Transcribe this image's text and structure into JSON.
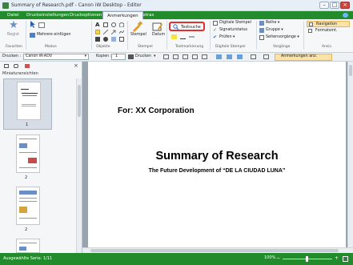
{
  "window": {
    "title": "Summary of Research.pdf - Canon iW Desktop - Editor",
    "min": "–",
    "max": "□",
    "close": "×"
  },
  "ribbon_tabs": [
    "Datei",
    "Druckeinstellungen",
    "Druckoptionen",
    "Anmerkungen",
    "Extras"
  ],
  "ribbon": {
    "regist_label": "Regist",
    "favoriten_group": "Favoriten",
    "mehrere_einfuegen": "Mehrere einfügen",
    "modus_group": "Modus",
    "objekte_group": "Objekte",
    "stempel_btn": "Stempel",
    "datum_btn": "Datum",
    "stempel_group": "Stempel",
    "textsuche_btn": "Textsuche",
    "textmarkierung_group": "Textmarkierung",
    "digitale_stempel": "Digitale Stempel",
    "signaturstatus": "Signaturstatus",
    "pruefen": "Prüfen ▾",
    "digitale_stempel_group": "Digitale Stempel",
    "reihe": "Reihe ▾",
    "gruppe": "Gruppe ▾",
    "seitenvorgaenge": "Seitenvorgänge ▾",
    "vorgaenge_group": "Vorgänge",
    "navigation": "Navigation",
    "formatsmt": "Formatsmt.",
    "ansicht_group": "Ansic."
  },
  "toolbar": {
    "drucken_label": "Drucken :",
    "printer": "Canon iR-ADV",
    "kopien_label": "Kopien :",
    "kopien_value": "1",
    "drucken_btn": "Drucken",
    "anmerkungen_btn": "Anmerkungen anz."
  },
  "left_panel": {
    "heading": "Miniaturansichten",
    "thumbs": [
      {
        "num": "1"
      },
      {
        "num": "2"
      },
      {
        "num": "2"
      },
      {
        "num": "2"
      }
    ]
  },
  "document": {
    "for_line": "For: XX Corporation",
    "title": "Summary of Research",
    "subtitle": "The Future Development of “DE LA CIUDAD LUNA”"
  },
  "status": {
    "left": "Ausgewählte Serie: 1/11",
    "zoom": "100%"
  },
  "colors": {
    "accent_green": "#228b2b",
    "highlight_red": "#e03030"
  }
}
